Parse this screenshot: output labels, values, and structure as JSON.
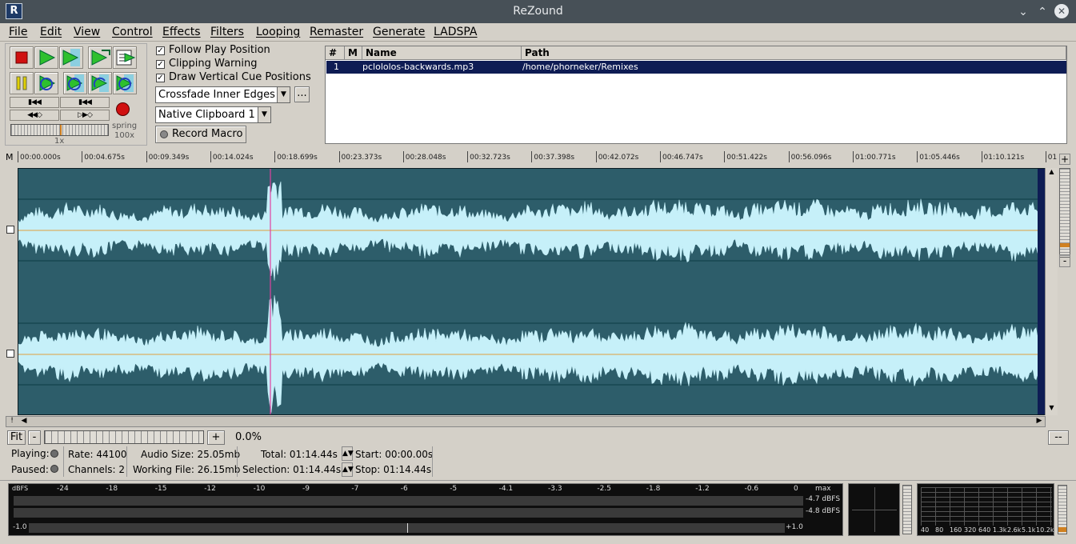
{
  "window": {
    "title": "ReZound",
    "logo": "R"
  },
  "menu": [
    "File",
    "Edit",
    "View",
    "Control",
    "Effects",
    "Filters",
    "Looping",
    "Remaster",
    "Generate",
    "LADSPA"
  ],
  "transport": {
    "spring_label": "spring",
    "spring_value": "100x",
    "speed_value": "1x"
  },
  "options": {
    "follow_play": "Follow Play Position",
    "clipping_warning": "Clipping Warning",
    "draw_cue": "Draw Vertical Cue Positions"
  },
  "crossfade": {
    "selected": "Crossfade Inner Edges",
    "extra_button": "..."
  },
  "clipboard": {
    "selected": "Native Clipboard 1"
  },
  "macro": {
    "label": "Record Macro"
  },
  "filelist": {
    "columns": [
      "#",
      "M",
      "Name",
      "Path"
    ],
    "rows": [
      {
        "num": "1",
        "m": "",
        "name": "pclololos-backwards.mp3",
        "path": "/home/phorneker/Remixes"
      }
    ]
  },
  "timeline": {
    "marker": "M",
    "ticks": [
      "00:00.000s",
      "00:04.675s",
      "00:09.349s",
      "00:14.024s",
      "00:18.699s",
      "00:23.373s",
      "00:28.048s",
      "00:32.723s",
      "00:37.398s",
      "00:42.072s",
      "00:46.747s",
      "00:51.422s",
      "00:56.096s",
      "01:00.771s",
      "01:05.446s",
      "01:10.121s",
      "01"
    ]
  },
  "zoom": {
    "fit": "Fit",
    "minus": "-",
    "plus": "+",
    "percent": "0.0%",
    "dashes": "--",
    "vplus": "+",
    "vminus": "-"
  },
  "stats": {
    "playing_label": "Playing:",
    "paused_label": "Paused:",
    "rate_label": "Rate:",
    "rate": "44100",
    "channels_label": "Channels:",
    "channels": "2",
    "audio_size_label": "Audio Size:",
    "audio_size": "25.05mb",
    "working_file_label": "Working File:",
    "working_file": "26.15mb",
    "total_label": "Total:",
    "total": "01:14.44s",
    "selection_label": "Selection:",
    "selection": "01:14.44s",
    "start_label": "Start:",
    "start": "00:00.00s",
    "stop_label": "Stop:",
    "stop": "01:14.44s"
  },
  "meters": {
    "unit": "dBFS",
    "scale": [
      "-24",
      "-18",
      "-15",
      "-12",
      "-10",
      "-9",
      "-7",
      "-6",
      "-5",
      "-4.1",
      "-3.3",
      "-2.5",
      "-1.8",
      "-1.2",
      "-0.6",
      "0"
    ],
    "max_label": "max",
    "max_l": "-4.7 dBFS",
    "max_r": "-4.8 dBFS",
    "balance_left": "-1.0",
    "balance_right": "+1.0",
    "balance": 0.0
  },
  "analyzer": {
    "freqs": [
      "40",
      "80",
      "160",
      "320",
      "640",
      "1.3k",
      "2.6k",
      "5.1k",
      "10.2k"
    ]
  },
  "colors": {
    "waveform_bg": "#2d5d6a",
    "waveform_fill": "#c6f0f9",
    "selection_bar": "#0e1c54",
    "cursor": "#e040a0"
  }
}
